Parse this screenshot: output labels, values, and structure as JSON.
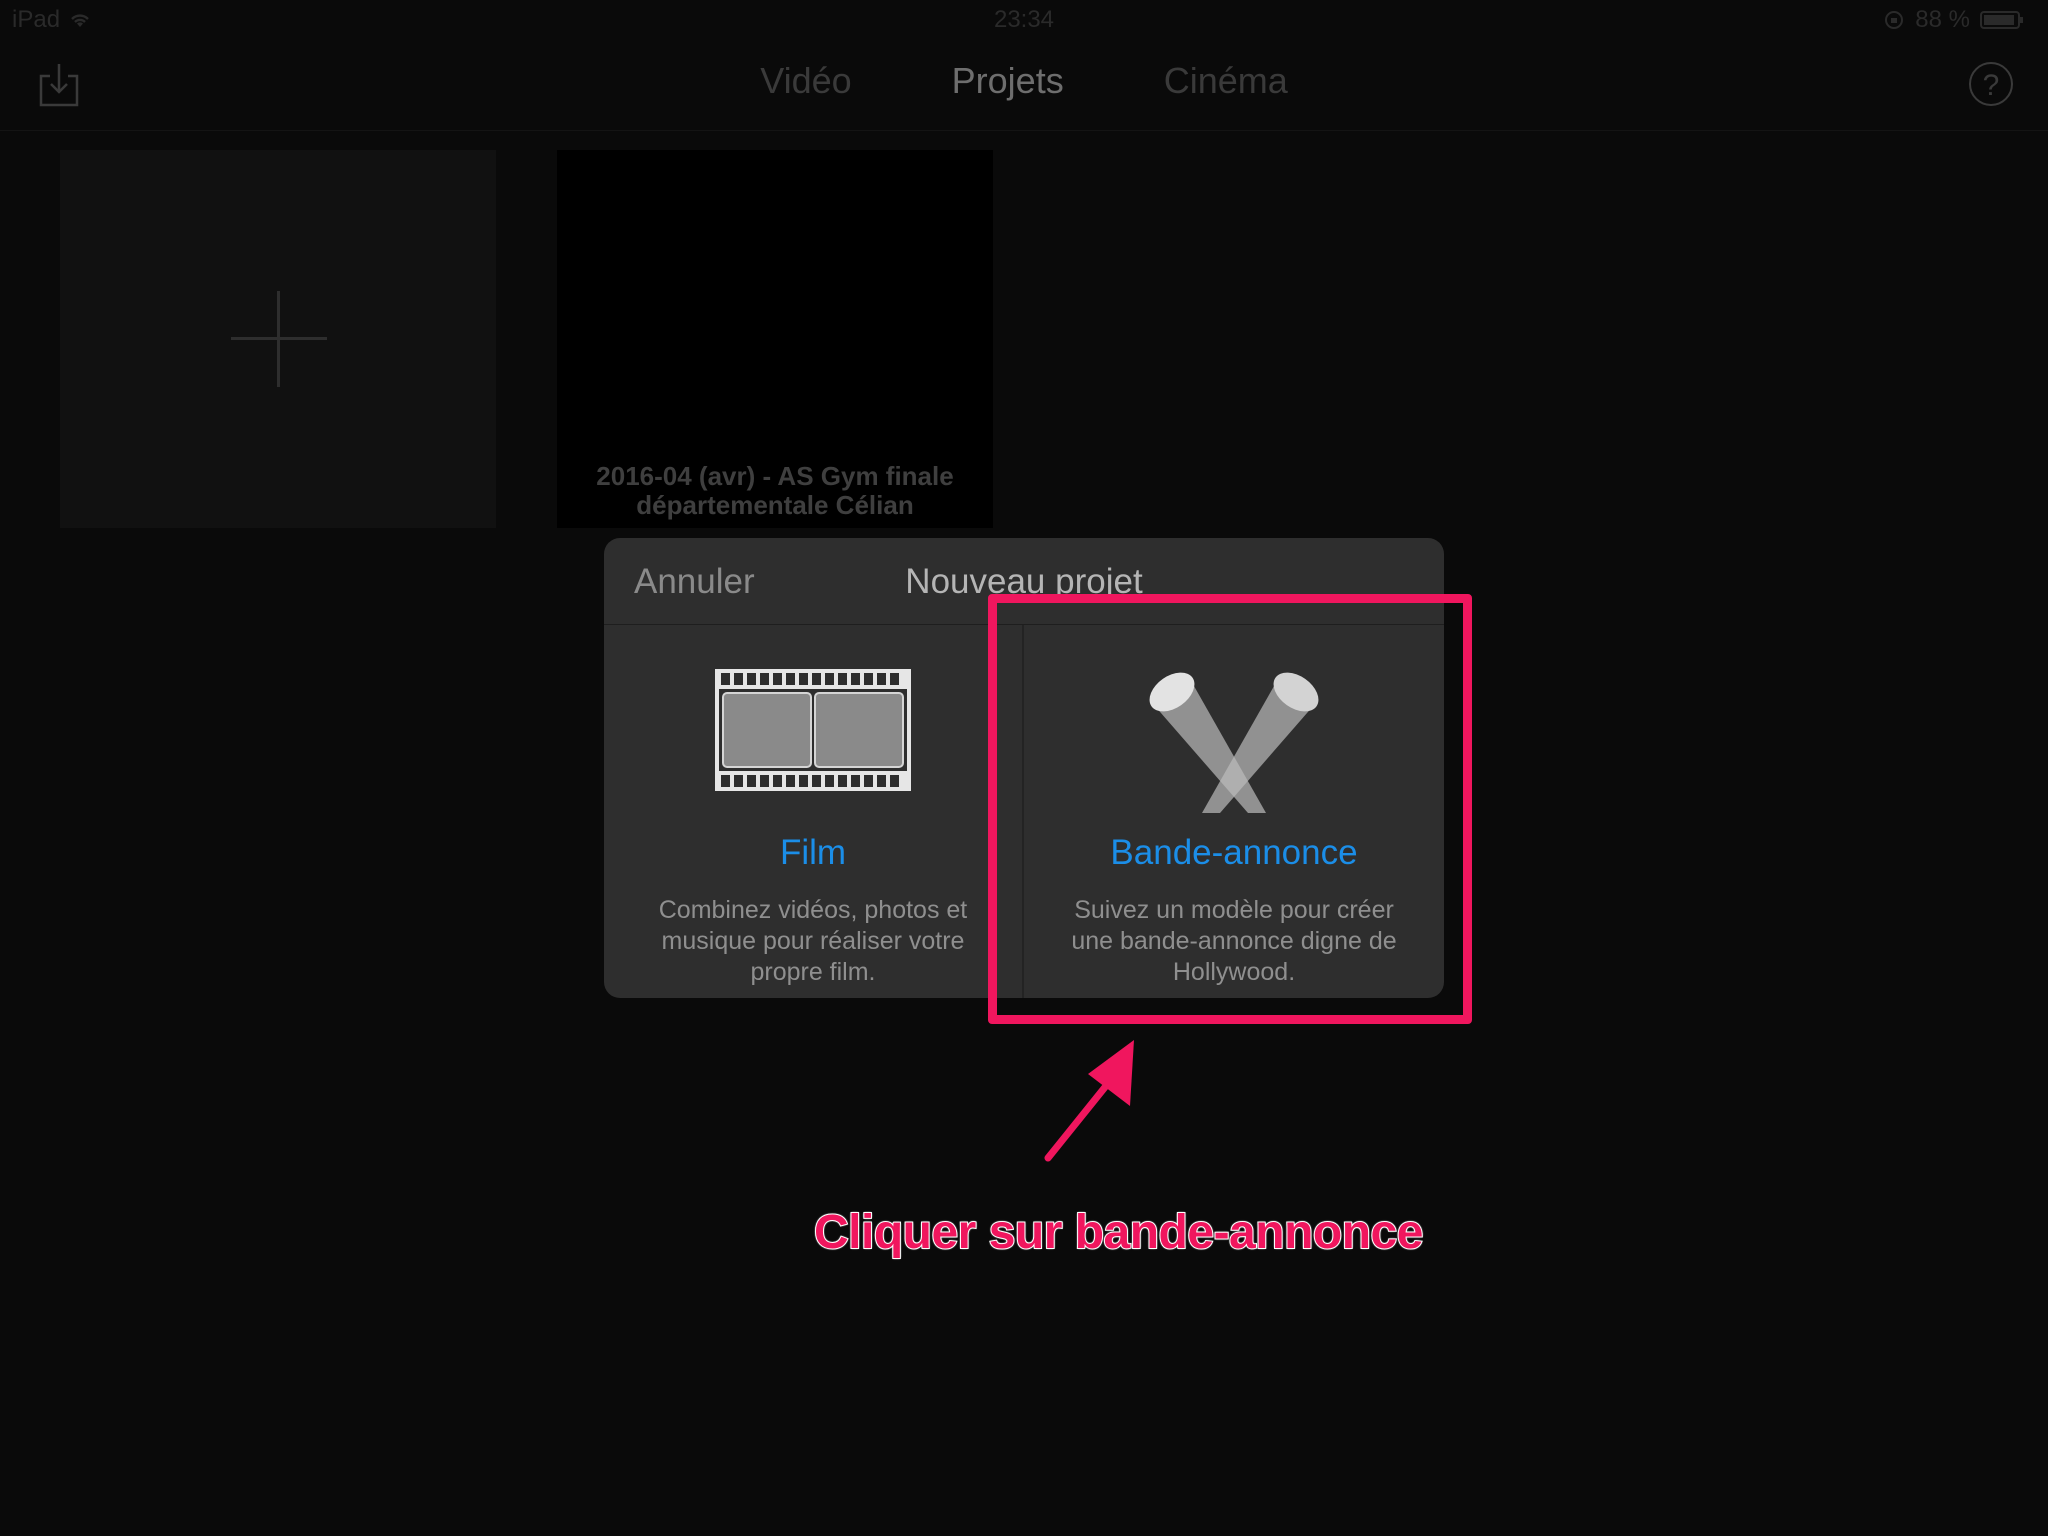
{
  "status_bar": {
    "device": "iPad",
    "time": "23:34",
    "battery": "88 %"
  },
  "nav": {
    "tabs": [
      {
        "label": "Vidéo",
        "active": false
      },
      {
        "label": "Projets",
        "active": true
      },
      {
        "label": "Cinéma",
        "active": false
      }
    ],
    "help_label": "?"
  },
  "projects": [
    {
      "title": "2016-04 (avr) - AS Gym finale départementale Célian"
    }
  ],
  "dialog": {
    "cancel_label": "Annuler",
    "title": "Nouveau projet",
    "options": [
      {
        "label": "Film",
        "description": "Combinez vidéos, photos et musique pour réaliser votre propre film.",
        "icon": "film-strip-icon"
      },
      {
        "label": "Bande-annonce",
        "description": "Suivez un modèle pour créer une bande-annonce digne de Hollywood.",
        "icon": "spotlights-icon"
      }
    ]
  },
  "annotation": {
    "instruction": "Cliquer sur bande-annonce",
    "color": "#f0165e"
  },
  "colors": {
    "accent": "#1b8ee8",
    "background": "#0a0a0a",
    "dialog": "#2e2e2e"
  }
}
